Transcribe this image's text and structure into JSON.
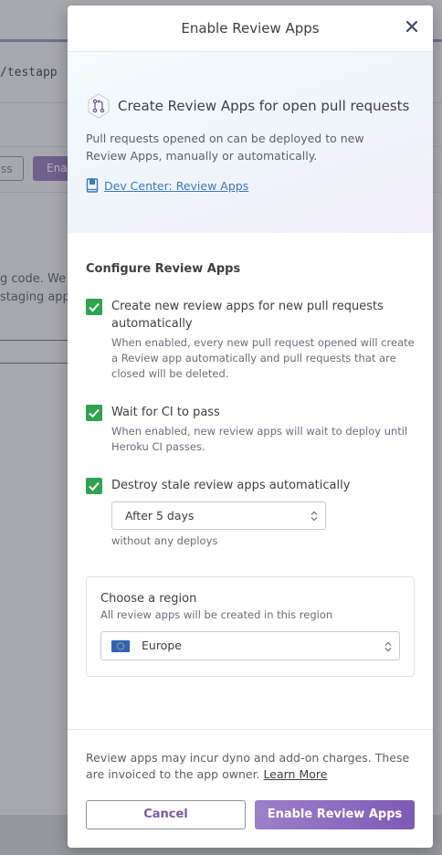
{
  "background": {
    "app_path": "/testapp",
    "btn_outline_label": "ss",
    "btn_purple_label": "Ena",
    "text_line1": "g code. We",
    "text_line2": "staging app"
  },
  "modal": {
    "title": "Enable Review Apps",
    "hero": {
      "title": "Create Review Apps for open pull requests",
      "description": "Pull requests opened on can be deployed to new Review Apps, manually or automatically.",
      "link_label": "Dev Center: Review Apps"
    },
    "configure": {
      "title": "Configure Review Apps",
      "options": [
        {
          "label": "Create new review apps for new pull requests automatically",
          "description": "When enabled, every new pull request opened will create a Review app automatically and pull requests that are closed will be deleted.",
          "checked": true
        },
        {
          "label": "Wait for CI to pass",
          "description": "When enabled, new review apps will wait to deploy until Heroku CI passes.",
          "checked": true
        },
        {
          "label": "Destroy stale review apps automatically",
          "checked": true
        }
      ],
      "stale_select_value": "After 5 days",
      "stale_select_note": "without any deploys"
    },
    "region": {
      "title": "Choose a region",
      "subtitle": "All review apps will be created in this region",
      "selected": "Europe"
    },
    "footer": {
      "note": "Review apps may incur dyno and add-on charges. These are invoiced to the app owner.",
      "learn_more": "Learn More",
      "cancel_label": "Cancel",
      "enable_label": "Enable Review Apps"
    }
  },
  "colors": {
    "accent": "#7f5ab5",
    "checkbox": "#2fa44f",
    "link": "#3a76c2"
  },
  "icons": {
    "close": "close-icon",
    "pull_request": "pull-request-icon",
    "book": "book-icon",
    "check": "checkmark-icon",
    "sort": "sort-arrows-icon",
    "flag": "eu-flag-icon"
  }
}
